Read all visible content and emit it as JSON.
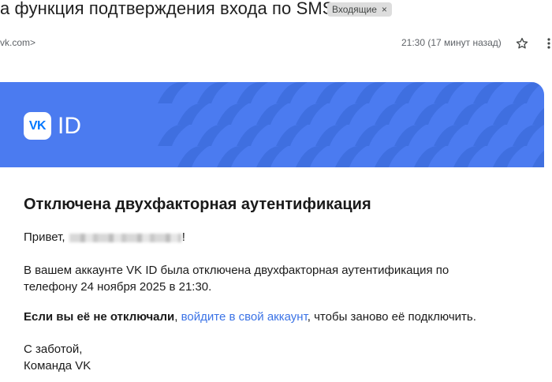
{
  "email": {
    "subject": "а функция подтверждения входа по SMS",
    "label": "Входящие",
    "label_close": "×",
    "sender": "vk.com>",
    "time": "21:30 (17 минут назад)",
    "star_icon": "star-icon",
    "more_icon": "more-vert-icon"
  },
  "message": {
    "logo_vk": "VK",
    "logo_id": "ID",
    "heading": "Отключена двухфакторная аутентификация",
    "greeting_start": "Привет,",
    "greeting_end": "!",
    "body": "В вашем аккаунте VK ID была отключена двухфакторная аутентификация по телефону 24 ноября 2025 в 21:30.",
    "warning_bold": "Если вы её не отключали",
    "warning_sep": ", ",
    "warning_link": "войдите в свой аккаунт",
    "warning_end": ", чтобы заново её подключить.",
    "sign_line1": "С заботой,",
    "sign_line2": "Команда VK"
  },
  "colors": {
    "banner": "#4b7bf0",
    "banner_pattern": "#3f6fe0",
    "link": "#3b73e6"
  }
}
